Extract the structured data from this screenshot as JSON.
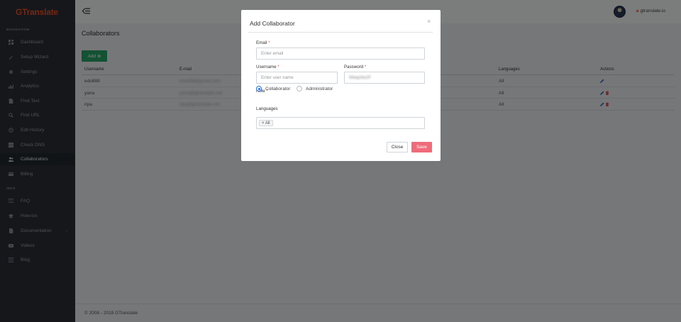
{
  "brand": {
    "logo_text": "GTranslate",
    "site_name": "gtranslate.io"
  },
  "sidebar": {
    "navigation_heading": "NAVIGATION",
    "info_heading": "INFO",
    "items": [
      {
        "label": "Dashboard",
        "icon": "dashboard-icon"
      },
      {
        "label": "Setup Wizard",
        "icon": "wand-icon"
      },
      {
        "label": "Settings",
        "icon": "gear-icon"
      },
      {
        "label": "Analytics",
        "icon": "chart-icon"
      },
      {
        "label": "Find Text",
        "icon": "file-search-icon"
      },
      {
        "label": "Find URL",
        "icon": "search-icon"
      },
      {
        "label": "Edit History",
        "icon": "history-icon"
      },
      {
        "label": "Check DNS",
        "icon": "server-icon"
      },
      {
        "label": "Collaborators",
        "icon": "users-icon",
        "active": true
      },
      {
        "label": "Billing",
        "icon": "credit-card-icon"
      }
    ],
    "info_items": [
      {
        "label": "FAQ",
        "icon": "question-icon"
      },
      {
        "label": "How-tos",
        "icon": "graduation-cap-icon"
      },
      {
        "label": "Documentation",
        "icon": "document-icon"
      },
      {
        "label": "Videos",
        "icon": "video-icon"
      },
      {
        "label": "Blog",
        "icon": "blog-icon"
      }
    ]
  },
  "page": {
    "title": "Collaborators",
    "add_button": "Add ⊕",
    "table": {
      "headers": [
        "Username",
        "E-mail",
        "Languages",
        "Actions"
      ],
      "rows": [
        {
          "username": "edo888",
          "email": "edo888@gmail.com",
          "languages": "All"
        },
        {
          "username": "yana",
          "email": "yana@gtranslate.net",
          "languages": "All"
        },
        {
          "username": "ripa",
          "email": "ripa@gtranslate.net",
          "languages": "All"
        }
      ]
    },
    "footer": "© 2008 - 2018 GTranslate"
  },
  "modal": {
    "title": "Add Collaborator",
    "close_glyph": "×",
    "email_label": "Email",
    "email_placeholder": "Enter email",
    "username_label": "Username",
    "username_placeholder": "Enter user name",
    "password_label": "Password",
    "password_value": "Wwqcfw1P",
    "required_mark": "*",
    "role_label": "Role",
    "role_options": [
      "Collaborator",
      "Administrator"
    ],
    "role_selected": "Collaborator",
    "languages_label": "Languages",
    "language_tag": "× All",
    "close_button": "Close",
    "save_button": "Save"
  },
  "colors": {
    "sidebar_bg": "#2a2f36",
    "accent_green": "#27a567",
    "save_button": "#ef6b7a",
    "brand_orange": "#f04e23",
    "radio_blue": "#1e6fe0"
  }
}
